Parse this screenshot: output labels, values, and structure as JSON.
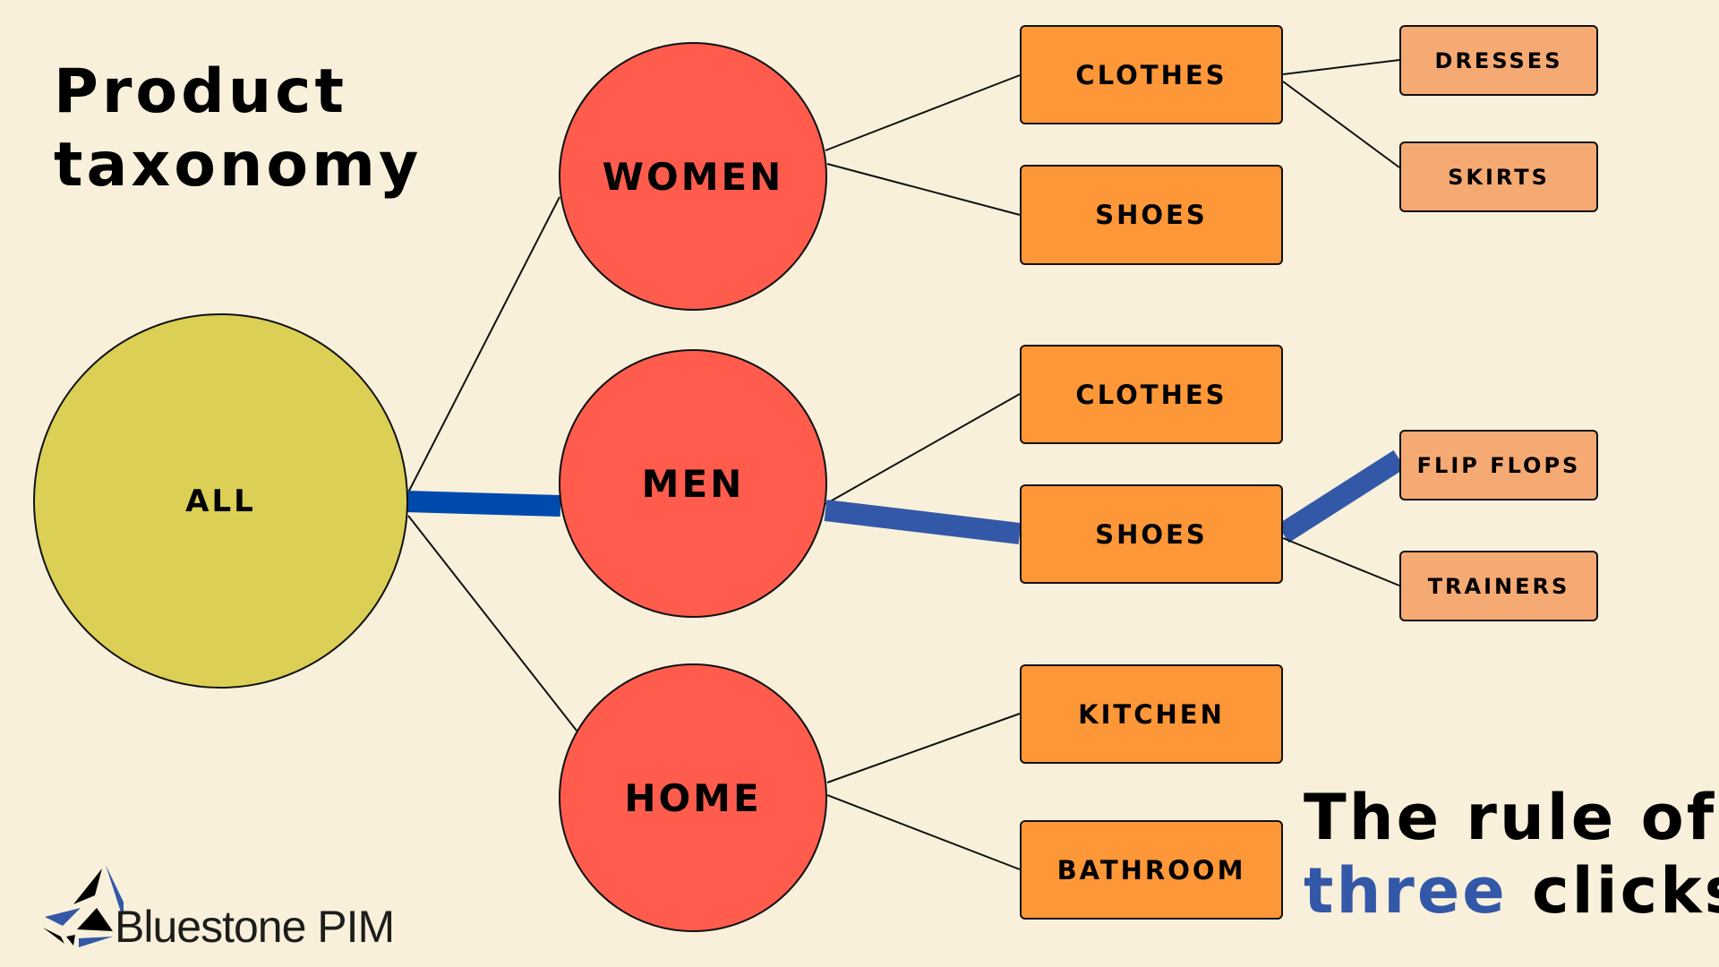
{
  "title": {
    "line1": "Product",
    "line2": "taxonomy"
  },
  "tagline": {
    "line1": "The rule of",
    "accent": "three",
    "rest": " clicks"
  },
  "logo": {
    "text": "Bluestone PIM"
  },
  "colors": {
    "background": "#f8f0da",
    "root": "#dbcf55",
    "level1": "#ff5c4d",
    "level2": "#fe9737",
    "level3": "#f5a973",
    "highlight_path": "#3358a8",
    "highlight_path_root": "#004aad",
    "accent_text": "#3358a8"
  },
  "tree": {
    "root": {
      "label": "ALL"
    },
    "level1": [
      {
        "label": "WOMEN"
      },
      {
        "label": "MEN"
      },
      {
        "label": "HOME"
      }
    ],
    "level2": [
      {
        "label": "CLOTHES",
        "parent": "WOMEN"
      },
      {
        "label": "SHOES",
        "parent": "WOMEN"
      },
      {
        "label": "CLOTHES",
        "parent": "MEN"
      },
      {
        "label": "SHOES",
        "parent": "MEN"
      },
      {
        "label": "KITCHEN",
        "parent": "HOME"
      },
      {
        "label": "BATHROOM",
        "parent": "HOME"
      }
    ],
    "level3": [
      {
        "label": "DRESSES",
        "parent": "WOMEN / CLOTHES"
      },
      {
        "label": "SKIRTS",
        "parent": "WOMEN / CLOTHES"
      },
      {
        "label": "FLIP FLOPS",
        "parent": "MEN / SHOES"
      },
      {
        "label": "TRAINERS",
        "parent": "MEN / SHOES"
      }
    ],
    "highlighted_path": [
      "ALL",
      "MEN",
      "SHOES",
      "FLIP FLOPS"
    ]
  }
}
